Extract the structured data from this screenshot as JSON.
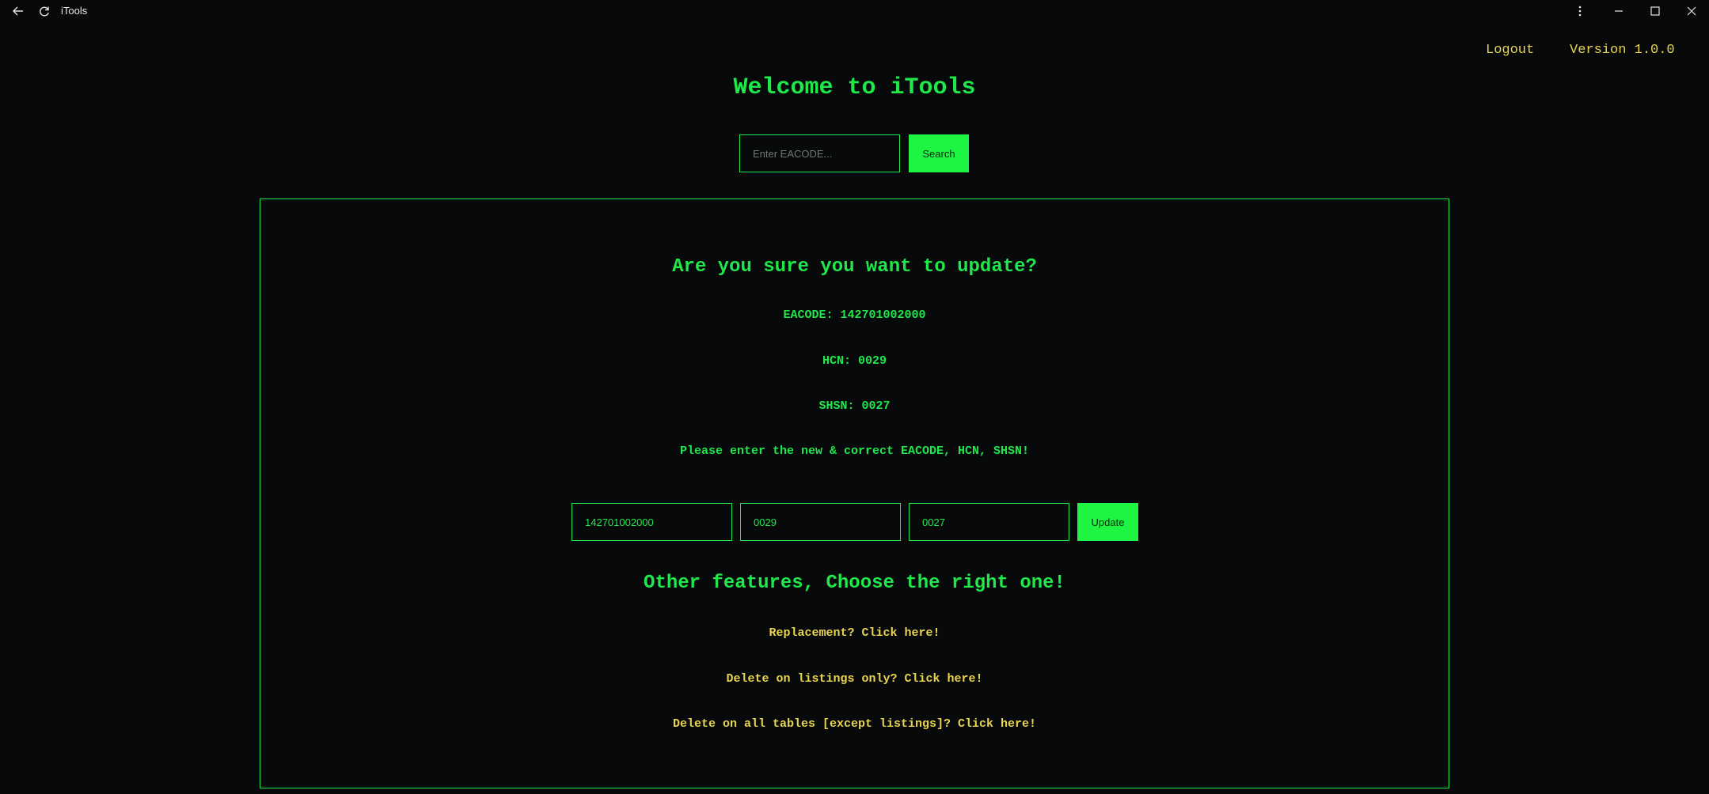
{
  "titlebar": {
    "title": "iTools"
  },
  "header": {
    "logout": "Logout",
    "version": "Version 1.0.0"
  },
  "welcome": "Welcome to iTools",
  "search": {
    "placeholder": "Enter EACODE...",
    "button": "Search"
  },
  "confirm": {
    "title": "Are you sure you want to update?",
    "eacode": "EACODE: 142701002000",
    "hcn": "HCN: 0029",
    "shsn": "SHSN: 0027",
    "prompt": "Please enter the new & correct EACODE, HCN, SHSN!"
  },
  "form": {
    "eacode_value": "142701002000",
    "hcn_value": "0029",
    "shsn_value": "0027",
    "update_button": "Update"
  },
  "other": {
    "title": "Other features, Choose the right one!",
    "links": [
      "Replacement? Click here!",
      "Delete on listings only? Click here!",
      "Delete on all tables [except listings]? Click here!"
    ]
  },
  "colors": {
    "accent": "#1ee84a",
    "link": "#e8d44d",
    "background": "#08090b"
  }
}
